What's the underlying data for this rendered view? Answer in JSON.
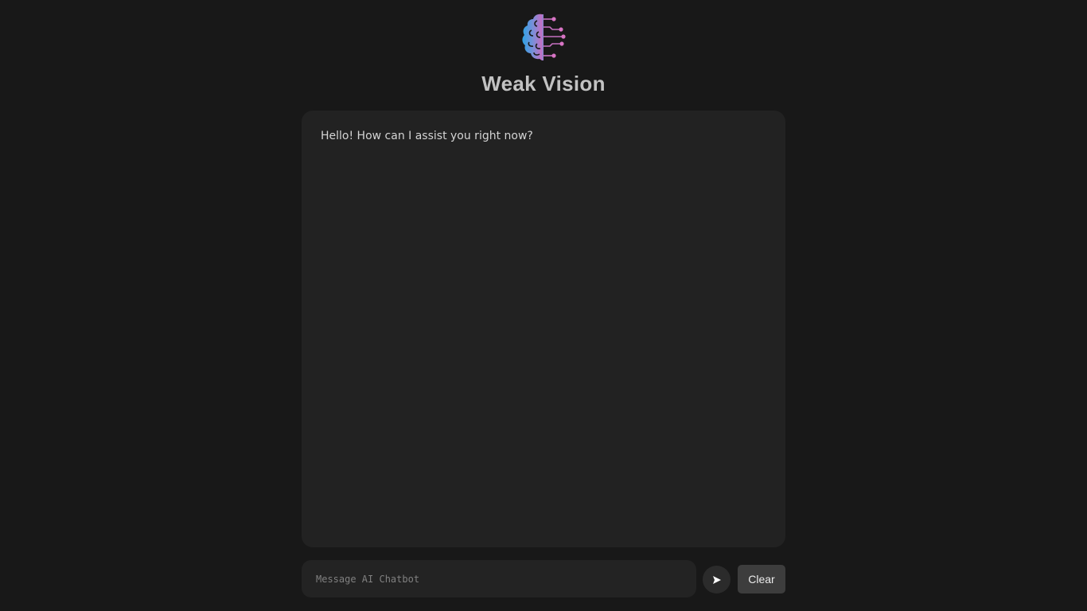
{
  "app": {
    "logo_icon": "brain-circuit-icon",
    "title": "Weak Vision"
  },
  "chat": {
    "messages": [
      {
        "role": "assistant",
        "text": "Hello! How can I assist you right now?"
      }
    ]
  },
  "composer": {
    "placeholder": "Message AI Chatbot",
    "value": "",
    "send_icon": "send-arrow-icon",
    "clear_label": "Clear"
  },
  "colors": {
    "background": "#181818",
    "panel": "#222222",
    "logo_gradient_start": "#3aa0e0",
    "logo_gradient_end": "#d070c0"
  }
}
